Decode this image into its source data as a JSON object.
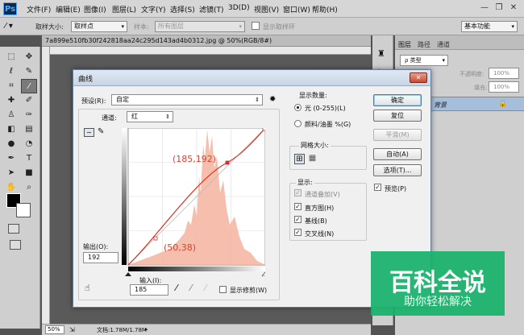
{
  "app": {
    "logo": "Ps"
  },
  "menu": [
    "文件(F)",
    "编辑(E)",
    "图像(I)",
    "图层(L)",
    "文字(Y)",
    "选择(S)",
    "滤镜(T)",
    "3D(D)",
    "视图(V)",
    "窗口(W)",
    "帮助(H)"
  ],
  "options_bar": {
    "sample_size_label": "取样大小:",
    "sample_size_value": "取样点",
    "sample_label": "样本:",
    "sample_value": "所有图层",
    "show_ring_label": "显示取样环",
    "workspace_value": "基本功能"
  },
  "document": {
    "tab_title": "7a899e510fb30f242818aa24c295d143ad4b0312.jpg @ 50%(RGB/8#)",
    "zoom": "50%",
    "doc_info": "文档:1.78M/1.78M"
  },
  "panels": {
    "tabs": [
      "图层",
      "路径",
      "通道"
    ],
    "filter_value": "ρ 类型",
    "opacity_label": "不透明度:",
    "opacity_value": "100%",
    "fill_label": "填充:",
    "fill_value": "100%",
    "layer_name": "背景"
  },
  "dialog": {
    "title": "曲线",
    "close": "✕",
    "preset_label": "预设(R):",
    "preset_value": "自定",
    "channel_label": "通道:",
    "channel_value": "红",
    "output_label": "输出(O):",
    "output_value": "192",
    "input_label": "输入(I):",
    "input_value": "185",
    "show_clipping_label": "显示修剪(W)",
    "point1_label": "(185,192)",
    "point2_label": "(50,38)",
    "display_amount_title": "显示数量:",
    "light_label": "光 (0-255)(L)",
    "pigment_label": "颜料/油墨 %(G)",
    "grid_size_title": "网格大小:",
    "show_title": "显示:",
    "channel_overlay_label": "通道叠加(V)",
    "histogram_label": "直方图(H)",
    "baseline_label": "基线(B)",
    "intersection_label": "交叉线(N)",
    "buttons": {
      "ok": "确定",
      "reset": "复位",
      "smooth": "平滑(M)",
      "auto": "自动(A)",
      "options": "选项(T)...",
      "preview": "预览(P)"
    }
  },
  "watermark": {
    "title": "百科全说",
    "subtitle": "助你轻松解决"
  }
}
